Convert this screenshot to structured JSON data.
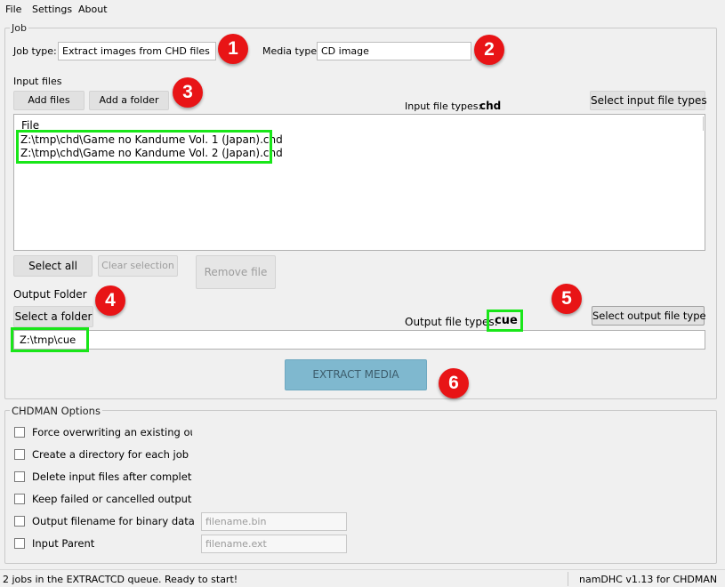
{
  "menu": {
    "file": "File",
    "settings": "Settings",
    "about": "About"
  },
  "job": {
    "group_title": "Job",
    "job_type_label": "Job type:",
    "job_type_value": "Extract images from CHD files",
    "media_type_label": "Media type:",
    "media_type_value": "CD image"
  },
  "input": {
    "section_label": "Input files",
    "add_files": "Add files",
    "add_folder": "Add a folder",
    "file_types_label": "Input file types:",
    "file_types_value": "chd",
    "select_types": "Select input file types",
    "list_header": "File",
    "files": [
      "Z:\\tmp\\chd\\Game no Kandume Vol. 1 (Japan).chd",
      "Z:\\tmp\\chd\\Game no Kandume Vol. 2 (Japan).chd"
    ],
    "select_all": "Select all",
    "clear_selection": "Clear selection",
    "remove_file": "Remove file"
  },
  "output": {
    "section_label": "Output Folder",
    "select_folder": "Select a folder",
    "file_types_label": "Output file types:",
    "file_types_value": "cue",
    "select_types": "Select output file type",
    "folder_path": "Z:\\tmp\\cue"
  },
  "extract_button": "EXTRACT MEDIA",
  "chdman": {
    "group_title": "CHDMAN Options",
    "options": [
      "Force overwriting an existing outp",
      "Create a directory for each job",
      "Delete input files after completing",
      "Keep failed or cancelled output fi",
      "Output filename for binary data",
      "Input Parent"
    ],
    "binary_placeholder": "filename.bin",
    "parent_placeholder": "filename.ext"
  },
  "badges": [
    "1",
    "2",
    "3",
    "4",
    "5",
    "6"
  ],
  "status": {
    "message": "2 jobs in the EXTRACTCD queue. Ready to start!",
    "version": "namDHC v1.13 for CHDMAN"
  },
  "colors": {
    "badge": "#e81416",
    "highlight": "#19e619",
    "extract_button": "#7fb8cf"
  }
}
